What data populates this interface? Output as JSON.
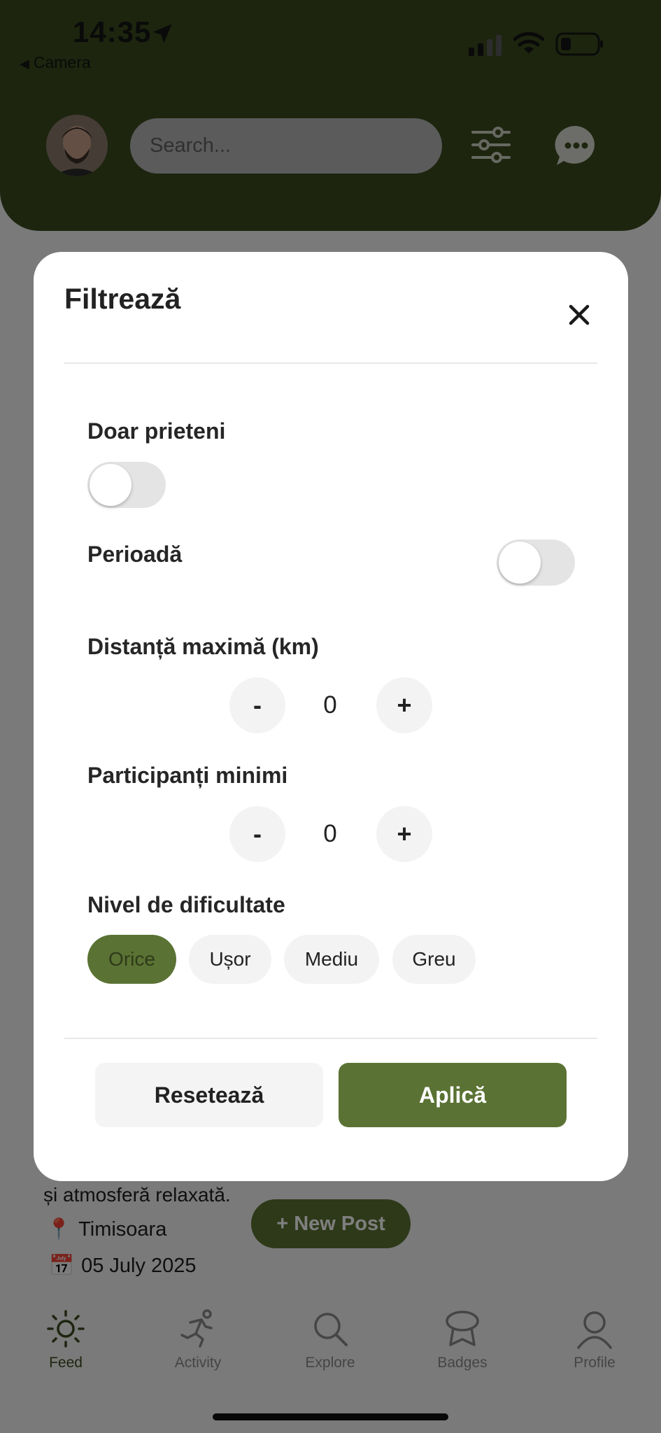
{
  "status_bar": {
    "time": "14:35",
    "back_label": "Camera"
  },
  "header": {
    "search_placeholder": "Search..."
  },
  "feed": {
    "text_line": "și atmosferă relaxată.",
    "location": "Timisoara",
    "date": "05 July 2025",
    "location_icon": "pin-icon",
    "date_icon": "calendar-icon"
  },
  "new_post_label": "+ New Post",
  "tabs": [
    {
      "label": "Feed",
      "icon": "sun-icon",
      "active": true
    },
    {
      "label": "Activity",
      "icon": "runner-icon",
      "active": false
    },
    {
      "label": "Explore",
      "icon": "search-icon",
      "active": false
    },
    {
      "label": "Badges",
      "icon": "badge-icon",
      "active": false
    },
    {
      "label": "Profile",
      "icon": "person-icon",
      "active": false
    }
  ],
  "modal": {
    "title": "Filtrează",
    "friends_only": {
      "label": "Doar prieteni",
      "on": false
    },
    "period": {
      "label": "Perioadă",
      "on": false
    },
    "max_distance": {
      "label": "Distanță maximă (km)",
      "value": "0",
      "minus": "-",
      "plus": "+"
    },
    "min_participants": {
      "label": "Participanți minimi",
      "value": "0",
      "minus": "-",
      "plus": "+"
    },
    "difficulty": {
      "label": "Nivel de dificultate",
      "options": [
        "Orice",
        "Ușor",
        "Mediu",
        "Greu"
      ],
      "selected": "Orice"
    },
    "reset_label": "Resetează",
    "apply_label": "Aplică"
  },
  "colors": {
    "header": "#3a4a1f",
    "accent": "#5a7233"
  }
}
